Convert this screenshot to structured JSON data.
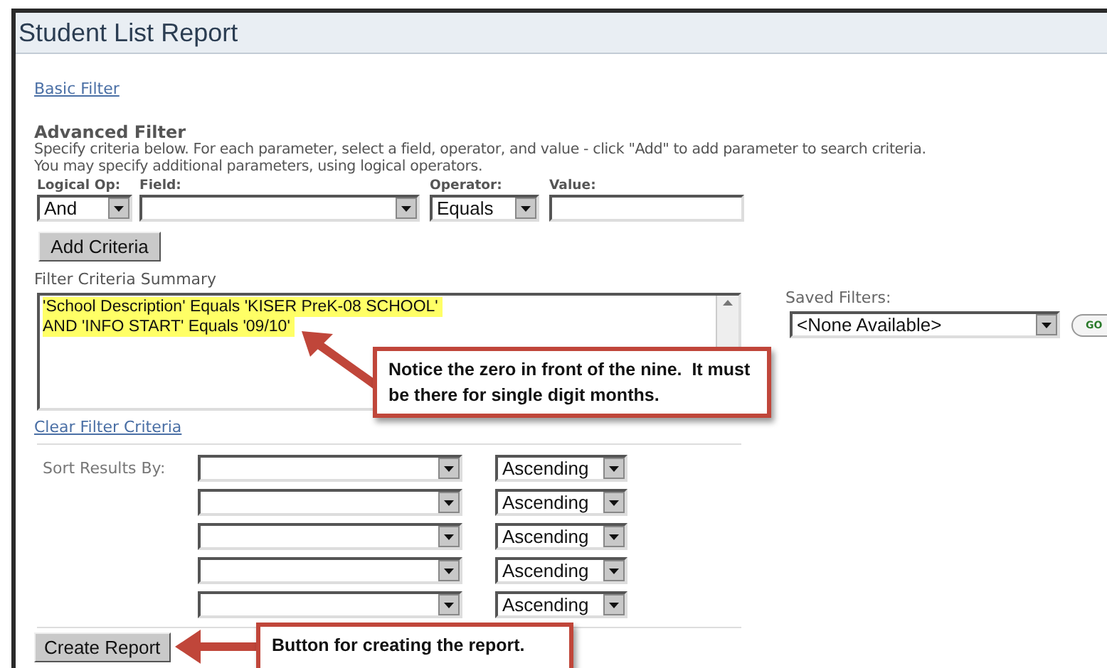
{
  "title": "Student List Report",
  "basic_filter_link": "Basic Filter",
  "advanced_filter": {
    "heading": "Advanced Filter",
    "description": [
      "Specify criteria below. For each parameter, select a field, operator, and value - click \"Add\" to add parameter to search criteria.",
      "You may specify additional parameters, using logical operators."
    ],
    "labels": {
      "logical_op": "Logical Op:",
      "field": "Field:",
      "operator": "Operator:",
      "value": "Value:"
    },
    "logical_op": "And",
    "operator": "Equals",
    "add_button": "Add Criteria"
  },
  "summary": {
    "label": "Filter Criteria Summary",
    "lines": [
      "'School Description' Equals 'KISER PreK-08 SCHOOL'",
      "AND 'INFO START' Equals '09/10'"
    ],
    "clear_link": "Clear Filter Criteria"
  },
  "saved_filters": {
    "label": "Saved Filters:",
    "value": "<None Available>",
    "go_button": "GO"
  },
  "sort": {
    "label": "Sort Results By:",
    "rows": [
      {
        "order": "Ascending"
      },
      {
        "order": "Ascending"
      },
      {
        "order": "Ascending"
      },
      {
        "order": "Ascending"
      },
      {
        "order": "Ascending"
      }
    ]
  },
  "create_button": "Create Report",
  "annotations": [
    {
      "kind": "up-left",
      "text": "Notice the zero in front of the nine.  It must be there for single digit months."
    },
    {
      "kind": "left",
      "text": "Button for creating the report."
    }
  ]
}
